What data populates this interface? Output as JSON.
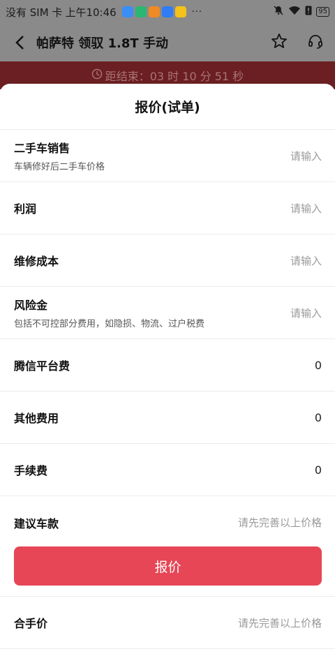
{
  "status_bar": {
    "carrier": "没有 SIM 卡",
    "time": "上午10:46",
    "dots": "···",
    "battery": "95",
    "app_badge_colors": [
      "#3a8ef6",
      "#2bb673",
      "#f08a24",
      "#2f7cf6",
      "#f4c21a"
    ]
  },
  "header": {
    "title": "帕萨特 领驭 1.8T 手动",
    "icons": [
      "back-arrow-icon",
      "star-icon",
      "headset-icon"
    ]
  },
  "countdown": {
    "text": "距结束：03 时 10 分 51 秒"
  },
  "sheet": {
    "title": "报价(试单)",
    "rows": [
      {
        "label": "二手车销售",
        "sub": "车辆修好后二手车价格",
        "value": "请输入"
      },
      {
        "label": "利润",
        "sub": "",
        "value": "请输入"
      },
      {
        "label": "维修成本",
        "sub": "",
        "value": "请输入"
      },
      {
        "label": "风险金",
        "sub": "包括不可控部分费用，如隐损、物流、过户税费",
        "value": "请输入"
      },
      {
        "label": "腾信平台费",
        "sub": "",
        "value": "0"
      },
      {
        "label": "其他费用",
        "sub": "",
        "value": "0"
      },
      {
        "label": "手续费",
        "sub": "",
        "value": "0"
      },
      {
        "label": "建议车款",
        "sub": "",
        "value": "请先完善以上价格"
      }
    ],
    "quote_button": "报价",
    "final_row": {
      "label": "合手价",
      "value": "请先完善以上价格"
    }
  },
  "colors": {
    "accent": "#e64655",
    "overlay_gray": "#8a8a8a",
    "countdown_bg": "#6b1f22"
  }
}
